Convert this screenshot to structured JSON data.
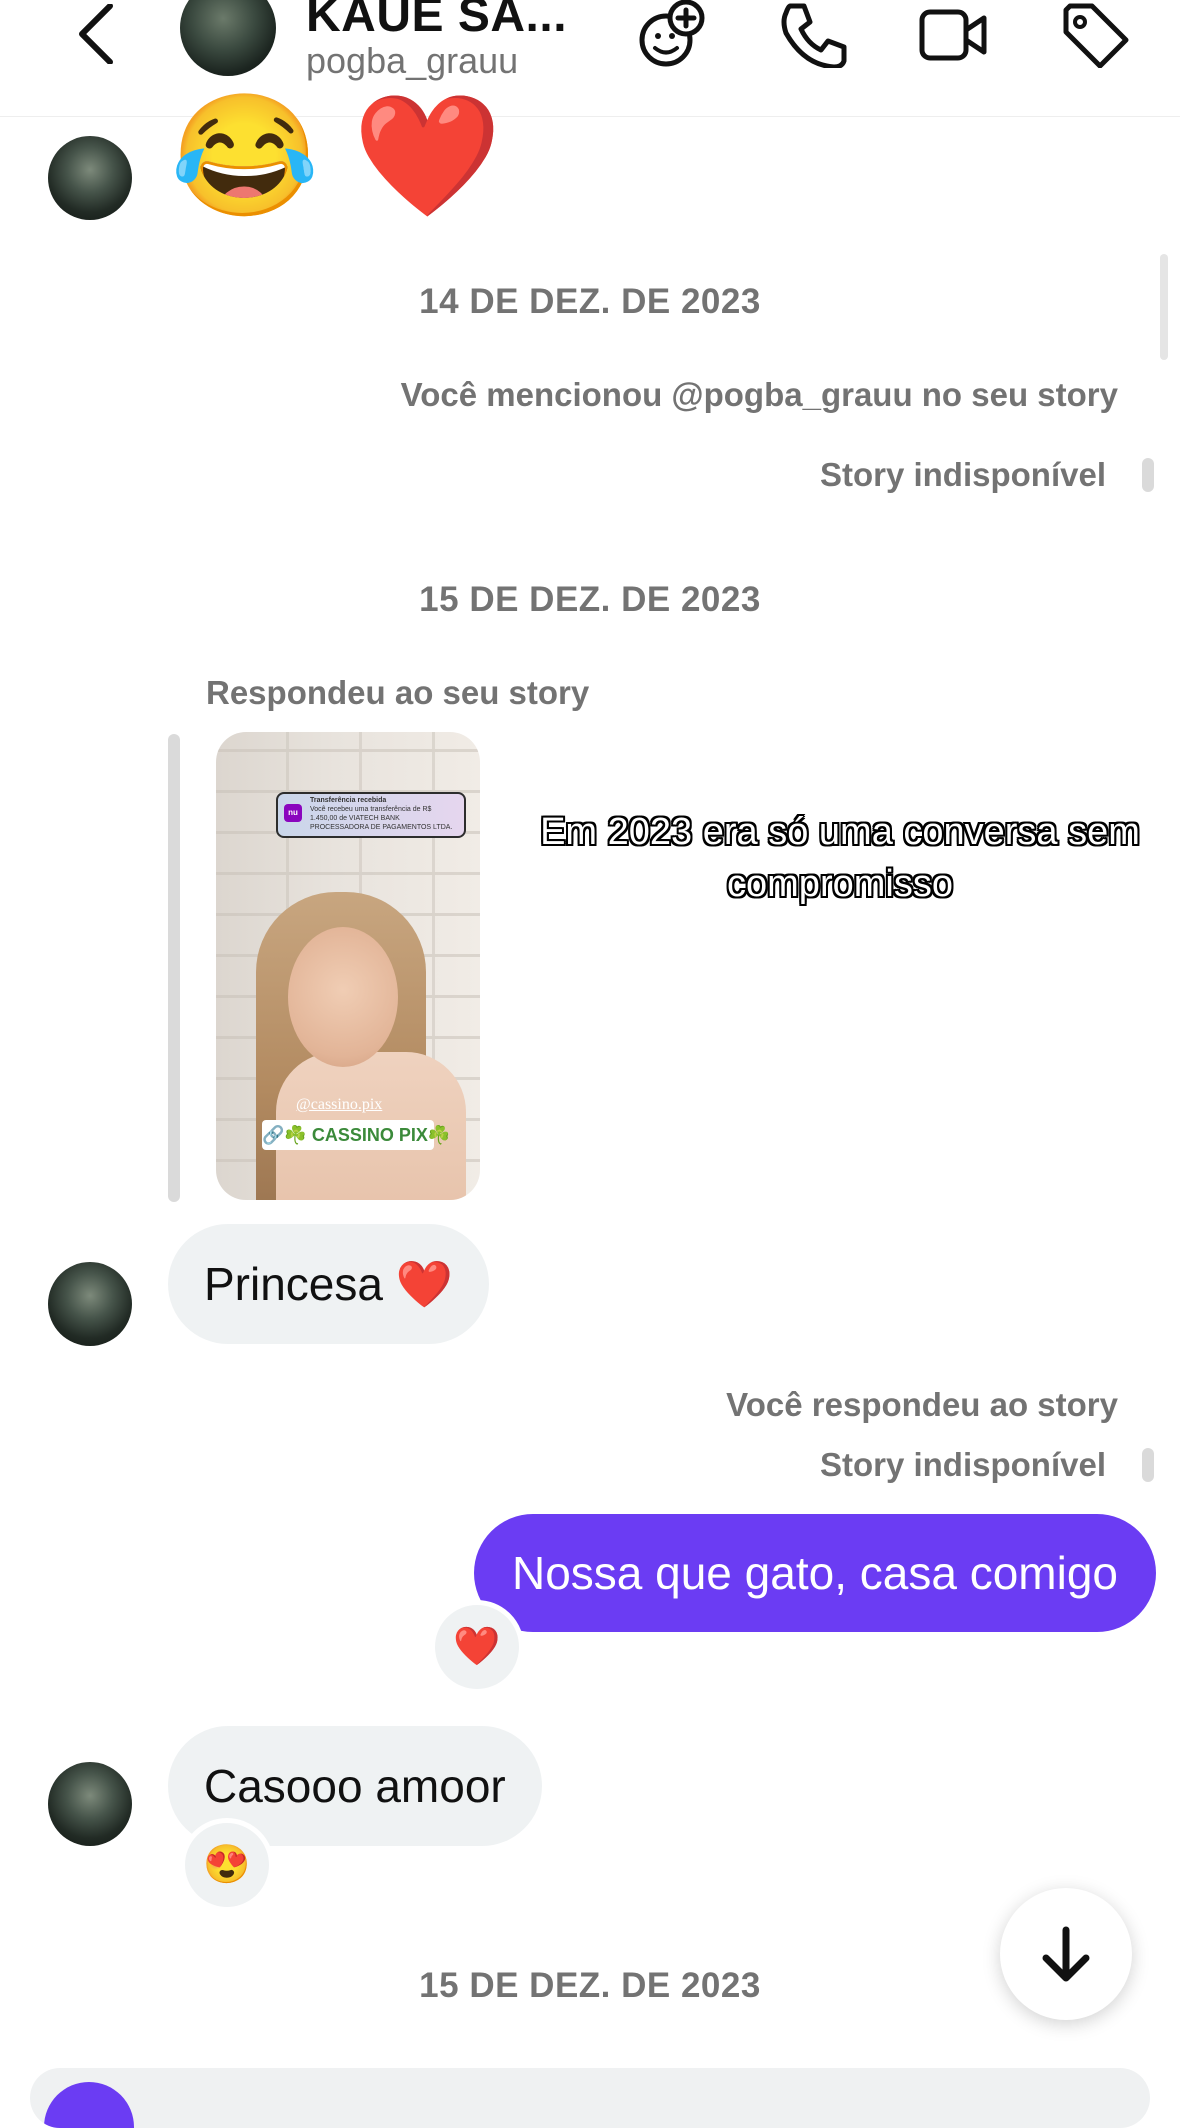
{
  "header": {
    "contact_name": "KAUE SA...",
    "username": "pogba_grauu",
    "icons": [
      "back-icon",
      "effects-icon",
      "phone-icon",
      "video-icon",
      "tag-icon"
    ]
  },
  "messages": {
    "top_emojis": "😂 ❤️",
    "date_1": "14 DE DEZ. DE 2023",
    "mention_note": "Você mencionou @pogba_grauu no seu story",
    "story_unavailable_1": "Story indisponível",
    "date_2": "15 DE DEZ. DE 2023",
    "replied_note": "Respondeu ao seu story",
    "story": {
      "notif_title": "Transferência recebida",
      "notif_body": "Você recebeu uma transferência de R$ 1.450,00 de VIATECH BANK PROCESSADORA DE PAGAMENTOS LTDA.",
      "notif_logo": "nu",
      "mention": "@cassino.pix",
      "link": "🔗☘️ CASSINO PIX☘️"
    },
    "overlay_caption": "Em 2023 era só uma conversa sem compromisso",
    "msg_princesa": "Princesa ❤️",
    "you_replied": "Você respondeu ao story",
    "story_unavailable_2": "Story indisponível",
    "msg_out": "Nossa que gato, casa comigo",
    "reaction_out": "❤️",
    "msg_casooo": "Casooo amoor",
    "reaction_in": "😍",
    "date_3": "15 DE DEZ. DE 2023"
  },
  "colors": {
    "accent": "#6b3cf3",
    "bubble_in": "#eff2f3",
    "meta_text": "#737373"
  }
}
